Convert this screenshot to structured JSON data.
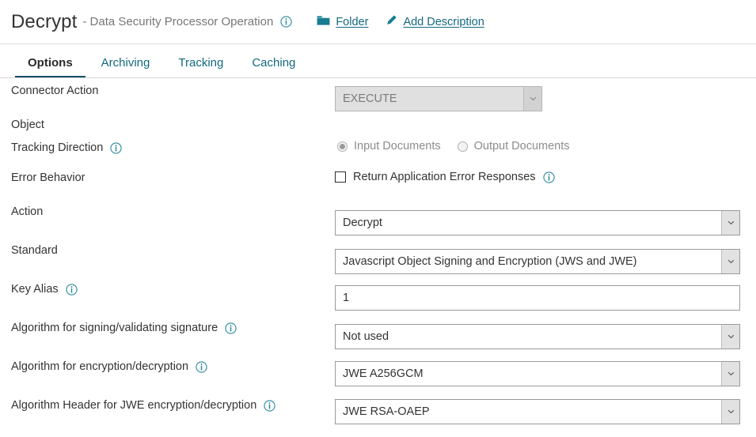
{
  "header": {
    "title": "Decrypt",
    "subtitle": "- Data Security Processor Operation",
    "title_info_icon": "info-icon",
    "folder_icon": "folder-icon",
    "folder_label": "Folder",
    "pencil_icon": "pencil-icon",
    "add_description_label": "Add Description"
  },
  "tabs": [
    {
      "label": "Options",
      "active": true
    },
    {
      "label": "Archiving",
      "active": false
    },
    {
      "label": "Tracking",
      "active": false
    },
    {
      "label": "Caching",
      "active": false
    }
  ],
  "form": {
    "connector_action": {
      "label": "Connector Action",
      "value": "EXECUTE",
      "disabled": true
    },
    "object": {
      "label": "Object"
    },
    "tracking_direction": {
      "label": "Tracking Direction",
      "info_icon": "info-icon",
      "options": [
        {
          "label": "Input Documents",
          "selected": true
        },
        {
          "label": "Output Documents",
          "selected": false
        }
      ]
    },
    "error_behavior": {
      "label": "Error Behavior",
      "checkbox_label": "Return Application Error Responses",
      "checked": false,
      "info_icon": "info-icon"
    },
    "action": {
      "label": "Action",
      "value": "Decrypt"
    },
    "standard": {
      "label": "Standard",
      "value": "Javascript Object Signing and Encryption (JWS and JWE)"
    },
    "key_alias": {
      "label": "Key Alias",
      "info_icon": "info-icon",
      "value": "1"
    },
    "algorithm_signing": {
      "label": "Algorithm for signing/validating signature",
      "info_icon": "info-icon",
      "value": "Not used"
    },
    "algorithm_encryption": {
      "label": "Algorithm for encryption/decryption",
      "info_icon": "info-icon",
      "value": "JWE A256GCM"
    },
    "algorithm_header_jwe": {
      "label": "Algorithm Header for JWE encryption/decryption",
      "info_icon": "info-icon",
      "value": "JWE RSA-OAEP"
    }
  },
  "colors": {
    "teal": "#13697f",
    "active_tab_underline": "#14506b",
    "text": "#333333",
    "muted": "#777777"
  }
}
